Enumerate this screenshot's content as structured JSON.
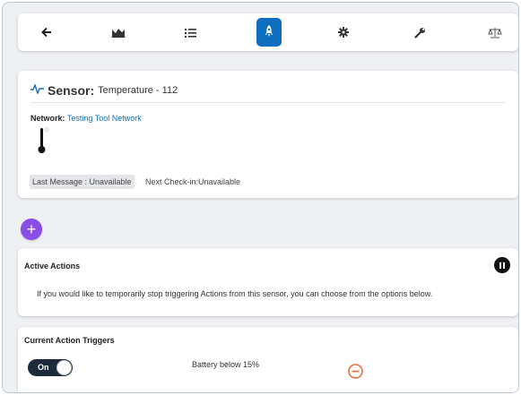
{
  "toolbar": {
    "items": [
      {
        "icon": "back-arrow-icon"
      },
      {
        "icon": "chart-area-icon"
      },
      {
        "icon": "list-icon"
      },
      {
        "icon": "rocket-icon",
        "active": true
      },
      {
        "icon": "gear-icon"
      },
      {
        "icon": "wrench-icon"
      },
      {
        "icon": "scale-icon"
      }
    ]
  },
  "sensor": {
    "label": "Sensor:",
    "name": "Temperature - 112",
    "network_key": "Network:",
    "network_value": "Testing Tool Network",
    "last_message": "Last Message : Unavailable",
    "next_checkin": "Next Check-in:Unavailable"
  },
  "add_button": {
    "label": "+"
  },
  "active_actions": {
    "title": "Active Actions",
    "description": "If you would like to temporarily stop triggering Actions from this sensor, you can choose from the options below."
  },
  "triggers": {
    "title": "Current Action Triggers",
    "items": [
      {
        "toggle_label": "On",
        "text": "Battery below 15%"
      }
    ]
  },
  "colors": {
    "accent": "#0d6fbd",
    "add_button": "#8a4de8",
    "remove": "#e8703a",
    "toggle_bg": "#1c2a3a"
  }
}
